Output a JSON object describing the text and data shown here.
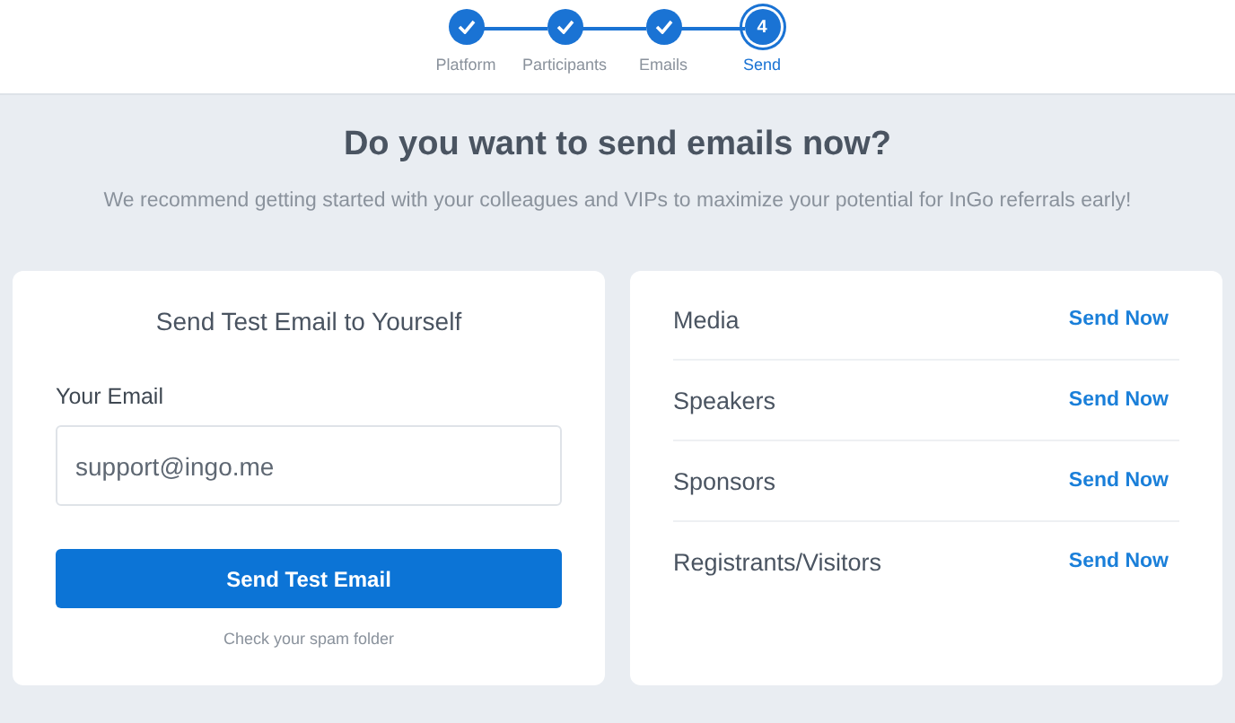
{
  "steps": [
    {
      "label": "Platform",
      "completed": true,
      "selected": false
    },
    {
      "label": "Participants",
      "completed": true,
      "selected": false
    },
    {
      "label": "Emails",
      "completed": true,
      "selected": false
    },
    {
      "number": "4",
      "label": "Send",
      "completed": false,
      "selected": true
    }
  ],
  "heading": "Do you want to send emails now?",
  "subtitle": "We recommend getting started with your colleagues and VIPs to maximize your potential for InGo referrals early!",
  "test_card": {
    "title": "Send Test Email to Yourself",
    "field_label": "Your Email",
    "email_value": "support@ingo.me",
    "button": "Send Test Email",
    "note": "Check your spam folder"
  },
  "groups": [
    {
      "name": "Media",
      "action": "Send Now"
    },
    {
      "name": "Speakers",
      "action": "Send Now"
    },
    {
      "name": "Sponsors",
      "action": "Send Now"
    },
    {
      "name": "Registrants/Visitors",
      "action": "Send Now"
    }
  ]
}
